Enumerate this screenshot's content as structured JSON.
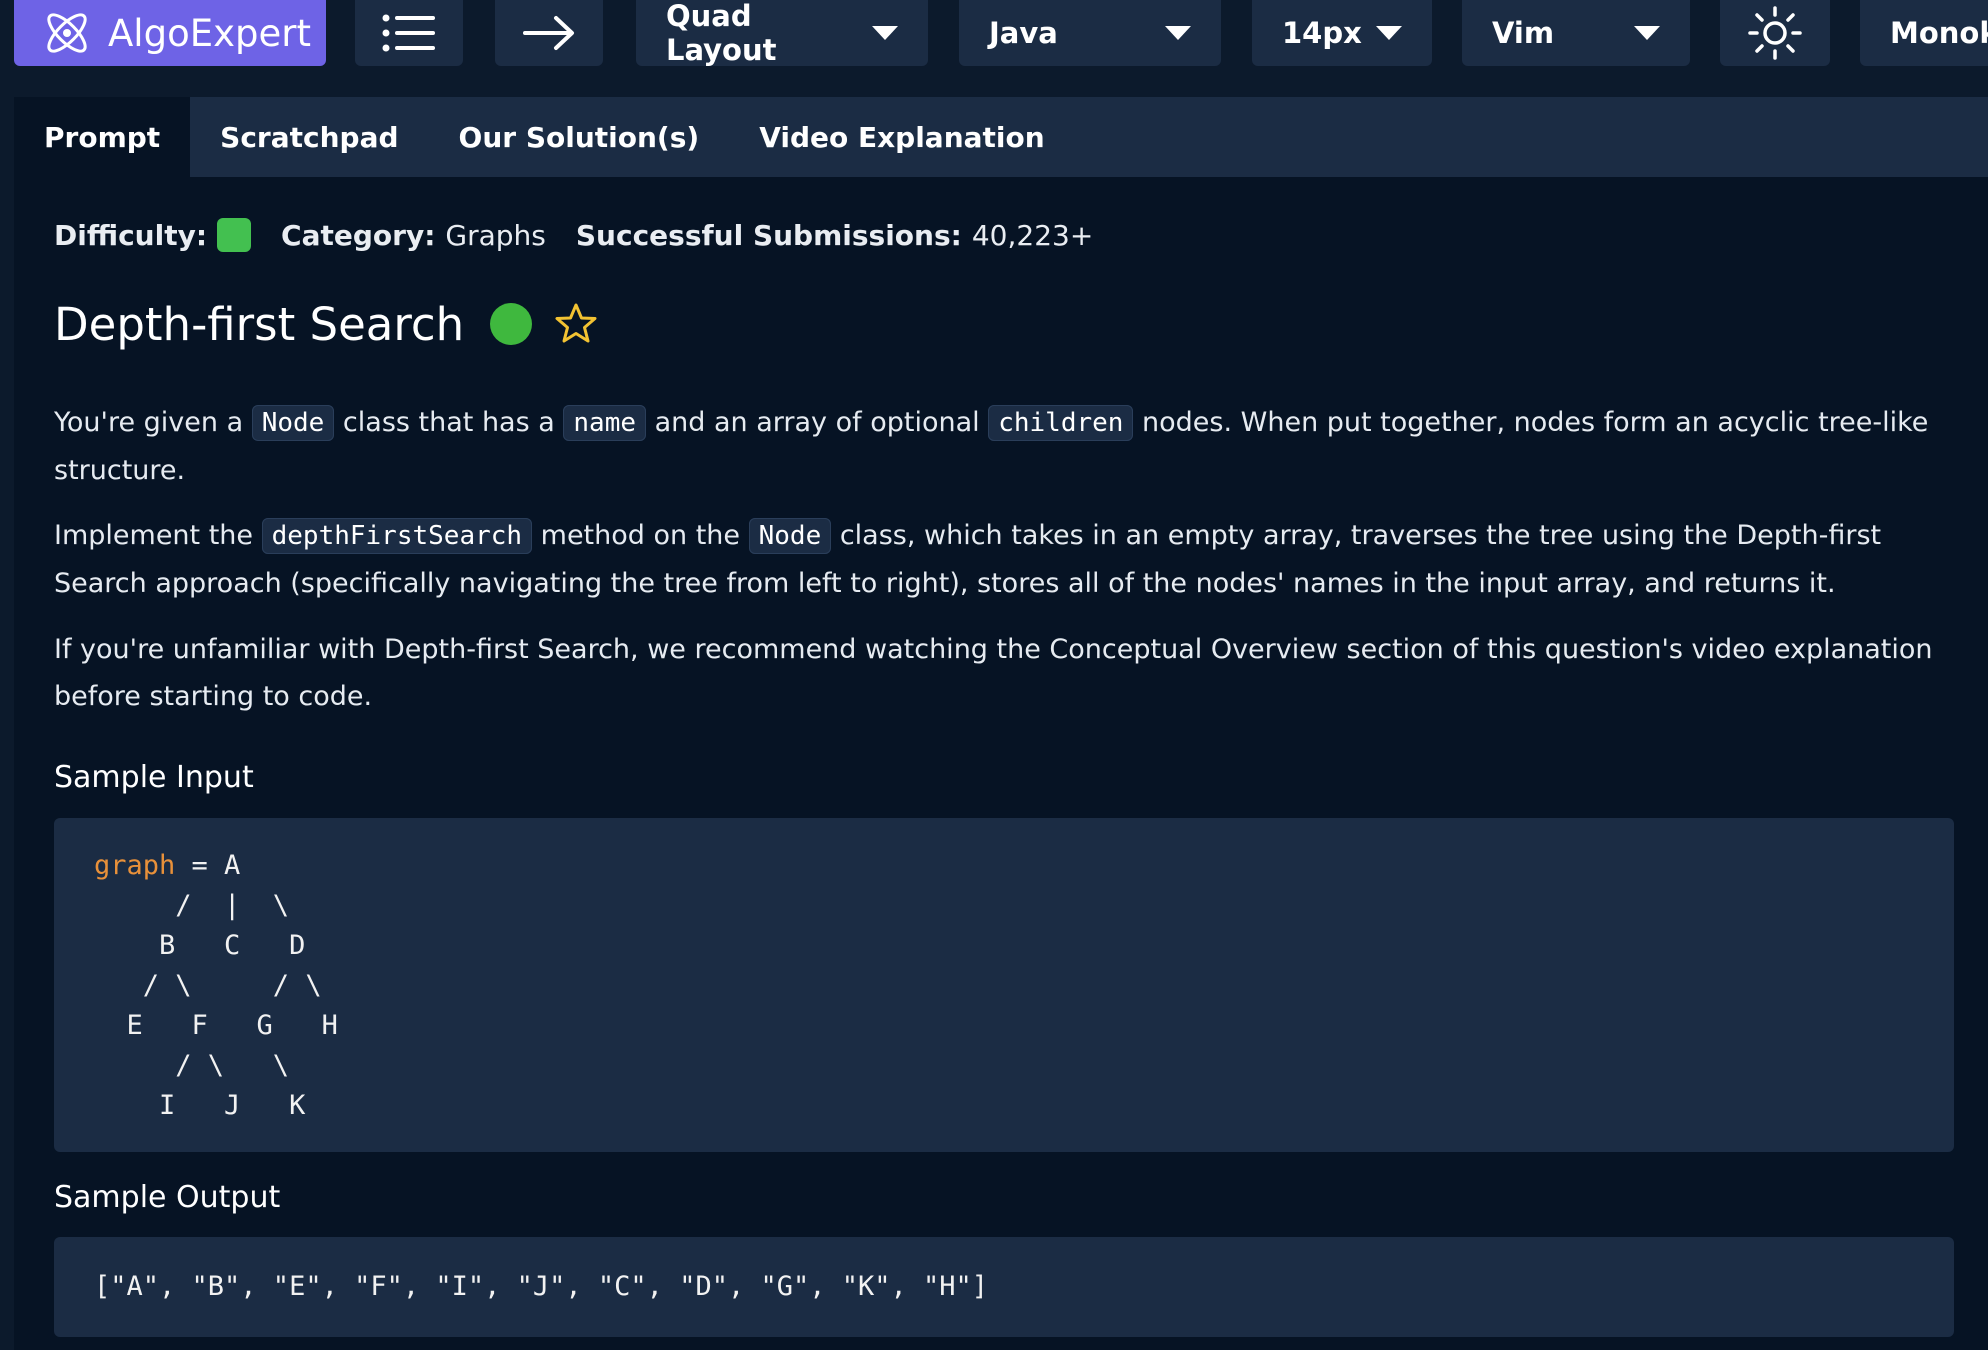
{
  "toolbar": {
    "brand": "AlgoExpert",
    "layout_label": "Quad Layout",
    "language_label": "Java",
    "font_size_label": "14px",
    "keymap_label": "Vim",
    "theme_label": "Monok",
    "icons": [
      "menu-icon",
      "arrow-right-icon",
      "sun-icon"
    ]
  },
  "tabs": [
    {
      "label": "Prompt",
      "active": true
    },
    {
      "label": "Scratchpad",
      "active": false
    },
    {
      "label": "Our Solution(s)",
      "active": false
    },
    {
      "label": "Video Explanation",
      "active": false
    }
  ],
  "meta": {
    "difficulty_label": "Difficulty:",
    "category_label": "Category:",
    "category_value": "Graphs",
    "submissions_label": "Successful Submissions:",
    "submissions_value": "40,223+"
  },
  "question": {
    "title": "Depth-first Search"
  },
  "prompt": {
    "p1": [
      "You're given a ",
      "Node",
      " class that has a ",
      "name",
      " and an array of optional ",
      "children",
      " nodes. When put together, nodes form an acyclic tree-like structure."
    ],
    "p2": [
      "Implement the ",
      "depthFirstSearch",
      " method on the ",
      "Node",
      " class, which takes in an empty array, traverses the tree using the Depth-first Search approach (specifically navigating the tree from left to right), stores all of the nodes' names in the input array, and returns it."
    ],
    "p3": "If you're unfamiliar with Depth-first Search, we recommend watching the Conceptual Overview section of this question's video explanation before starting to code."
  },
  "sample_input": {
    "heading": "Sample Input",
    "keyword": "graph",
    "first_line_rest": " = A",
    "lines": [
      "     /  |  \\",
      "    B   C   D",
      "   / \\     / \\",
      "  E   F   G   H",
      "     / \\   \\",
      "    I   J   K"
    ]
  },
  "sample_output": {
    "heading": "Sample Output",
    "value": "[\"A\", \"B\", \"E\", \"F\", \"I\", \"J\", \"C\", \"D\", \"G\", \"K\", \"H\"]"
  },
  "colors": {
    "brand": "#6e63e6",
    "background": "#061324",
    "bar": "#1b2c44",
    "difficulty_easy": "#43c050",
    "keyword": "#e9913a",
    "star": "#f2c232"
  }
}
